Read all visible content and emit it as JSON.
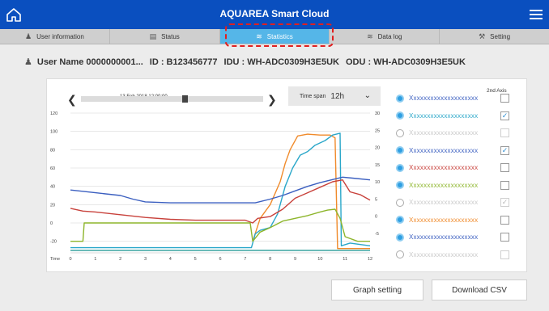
{
  "app": {
    "title": "AQUAREA Smart Cloud"
  },
  "tabs": [
    {
      "label": "User information",
      "icon": "user-icon"
    },
    {
      "label": "Status",
      "icon": "status-screen-icon"
    },
    {
      "label": "Statistics",
      "icon": "statistics-chart-icon",
      "active": true
    },
    {
      "label": "Data log",
      "icon": "data-log-icon"
    },
    {
      "label": "Setting",
      "icon": "wrench-icon"
    }
  ],
  "user": {
    "name": "User Name 0000000001...",
    "id": "ID : B123456777",
    "idu": "IDU : WH-ADC0309H3E5UK",
    "odu": "ODU : WH-ADC0309H3E5UK"
  },
  "graph": {
    "date": "13.Feb.2018 12:00:00",
    "slider_position": 0.57,
    "timespan_label": "Time span",
    "timespan_value": "12h",
    "second_axis_label": "2nd Axis"
  },
  "legend": [
    {
      "label": "Xxxxxxxxxxxxxxxxxxxx",
      "color": "#3b5fc0",
      "enabled": true,
      "axis2": false
    },
    {
      "label": "Xxxxxxxxxxxxxxxxxxxx",
      "color": "#2aa7c9",
      "enabled": true,
      "axis2": true
    },
    {
      "label": "Xxxxxxxxxxxxxxxxxxxx",
      "color": "#c9c9c9",
      "enabled": false,
      "axis2": false
    },
    {
      "label": "Xxxxxxxxxxxxxxxxxxxx",
      "color": "#3b5fc0",
      "enabled": true,
      "axis2": true
    },
    {
      "label": "Xxxxxxxxxxxxxxxxxxxx",
      "color": "#c8413b",
      "enabled": true,
      "axis2": false
    },
    {
      "label": "Xxxxxxxxxxxxxxxxxxxx",
      "color": "#8db52b",
      "enabled": true,
      "axis2": false
    },
    {
      "label": "Xxxxxxxxxxxxxxxxxxxx",
      "color": "#c9c9c9",
      "enabled": false,
      "axis2": true
    },
    {
      "label": "Xxxxxxxxxxxxxxxxxxxx",
      "color": "#f08a2a",
      "enabled": true,
      "axis2": false
    },
    {
      "label": "Xxxxxxxxxxxxxxxxxxxx",
      "color": "#3b5fc0",
      "enabled": true,
      "axis2": false
    },
    {
      "label": "Xxxxxxxxxxxxxxxxxxxx",
      "color": "#c9c9c9",
      "enabled": false,
      "axis2": false
    }
  ],
  "buttons": {
    "graph_setting": "Graph setting",
    "download_csv": "Download CSV"
  },
  "chart_data": {
    "type": "line",
    "xlabel": "Time",
    "ylabel": "",
    "xlim": [
      0,
      12
    ],
    "ylim": [
      -30,
      120
    ],
    "y2lim": [
      -10,
      30
    ],
    "x_ticks": [
      0,
      1,
      2,
      3,
      4,
      5,
      6,
      7,
      8,
      9,
      10,
      11,
      12
    ],
    "y_ticks": [
      -20,
      0,
      20,
      40,
      60,
      80,
      100,
      120
    ],
    "y2_ticks": [
      -5,
      0,
      5,
      10,
      15,
      20,
      25,
      30
    ],
    "grid": true,
    "series": [
      {
        "color": "#f08a2a",
        "axis": 1,
        "points": [
          [
            7.3,
            -20
          ],
          [
            7.6,
            5
          ],
          [
            8,
            20
          ],
          [
            8.4,
            45
          ],
          [
            8.6,
            65
          ],
          [
            8.8,
            80
          ],
          [
            9.1,
            95
          ],
          [
            9.5,
            97
          ],
          [
            10,
            96
          ],
          [
            10.4,
            96
          ],
          [
            10.6,
            93
          ],
          [
            10.7,
            -28
          ],
          [
            12,
            -28
          ]
        ]
      },
      {
        "color": "#2aa7c9",
        "axis": 1,
        "points": [
          [
            0,
            -27
          ],
          [
            7.25,
            -27
          ],
          [
            7.4,
            -12
          ],
          [
            7.6,
            -8
          ],
          [
            8,
            -5
          ],
          [
            8.3,
            10
          ],
          [
            8.6,
            40
          ],
          [
            8.9,
            60
          ],
          [
            9.2,
            74
          ],
          [
            9.5,
            78
          ],
          [
            9.8,
            85
          ],
          [
            10.2,
            90
          ],
          [
            10.5,
            96
          ],
          [
            10.8,
            98
          ],
          [
            10.85,
            -25
          ],
          [
            11.2,
            -22
          ],
          [
            12,
            -25
          ]
        ]
      },
      {
        "color": "#3b5fc0",
        "axis": 1,
        "points": [
          [
            0,
            36
          ],
          [
            1,
            33
          ],
          [
            2,
            30
          ],
          [
            2.5,
            26
          ],
          [
            3,
            23
          ],
          [
            4,
            22
          ],
          [
            5,
            22
          ],
          [
            6,
            22
          ],
          [
            7,
            22
          ],
          [
            7.4,
            22
          ],
          [
            8,
            26
          ],
          [
            8.5,
            30
          ],
          [
            9,
            35
          ],
          [
            9.5,
            40
          ],
          [
            10,
            44
          ],
          [
            10.6,
            48
          ],
          [
            10.9,
            50
          ],
          [
            11.3,
            49
          ],
          [
            12,
            47
          ]
        ]
      },
      {
        "color": "#c8413b",
        "axis": 1,
        "points": [
          [
            0,
            16
          ],
          [
            0.5,
            13
          ],
          [
            1,
            12
          ],
          [
            2,
            9
          ],
          [
            3,
            6
          ],
          [
            4,
            4
          ],
          [
            5,
            3
          ],
          [
            6,
            3
          ],
          [
            7,
            3
          ],
          [
            7.3,
            0
          ],
          [
            7.5,
            5
          ],
          [
            8,
            7
          ],
          [
            8.5,
            15
          ],
          [
            9,
            27
          ],
          [
            9.5,
            33
          ],
          [
            10,
            39
          ],
          [
            10.5,
            45
          ],
          [
            10.9,
            47
          ],
          [
            11.2,
            34
          ],
          [
            11.6,
            31
          ],
          [
            12,
            25
          ]
        ]
      },
      {
        "color": "#8db52b",
        "axis": 1,
        "points": [
          [
            0,
            -20
          ],
          [
            0.5,
            -20
          ],
          [
            0.55,
            0
          ],
          [
            7.2,
            0
          ],
          [
            7.3,
            -20
          ],
          [
            7.6,
            -10
          ],
          [
            8,
            -5
          ],
          [
            8.5,
            2
          ],
          [
            9,
            5
          ],
          [
            9.5,
            8
          ],
          [
            10,
            12
          ],
          [
            10.3,
            14
          ],
          [
            10.6,
            15
          ],
          [
            10.8,
            5
          ],
          [
            11,
            -15
          ],
          [
            11.5,
            -20
          ],
          [
            12,
            -20
          ]
        ]
      },
      {
        "color": "#3aa3a0",
        "axis": 1,
        "points": [
          [
            0,
            -30
          ],
          [
            12,
            -30
          ]
        ]
      }
    ]
  }
}
